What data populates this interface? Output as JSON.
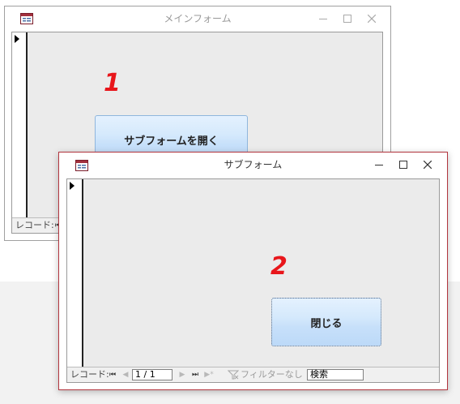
{
  "main_window": {
    "title": "メインフォーム",
    "open_subform_button": "サブフォームを開く",
    "annotation": "1",
    "nav_label": "レコード:",
    "nav_first": "⏮"
  },
  "sub_window": {
    "title": "サブフォーム",
    "close_button": "閉じる",
    "annotation": "2",
    "nav": {
      "label": "レコード:",
      "first": "⏮",
      "prev": "◀",
      "position": "1 / 1",
      "next": "▶",
      "last": "⏭",
      "new": "▶*",
      "filter_status": "フィルターなし",
      "search_placeholder": "検索"
    }
  },
  "colors": {
    "annotation_red": "#e8161b",
    "active_border": "#b2353e",
    "button_gradient_top": "#e4f1fe",
    "button_gradient_bottom": "#bcd9f8"
  }
}
